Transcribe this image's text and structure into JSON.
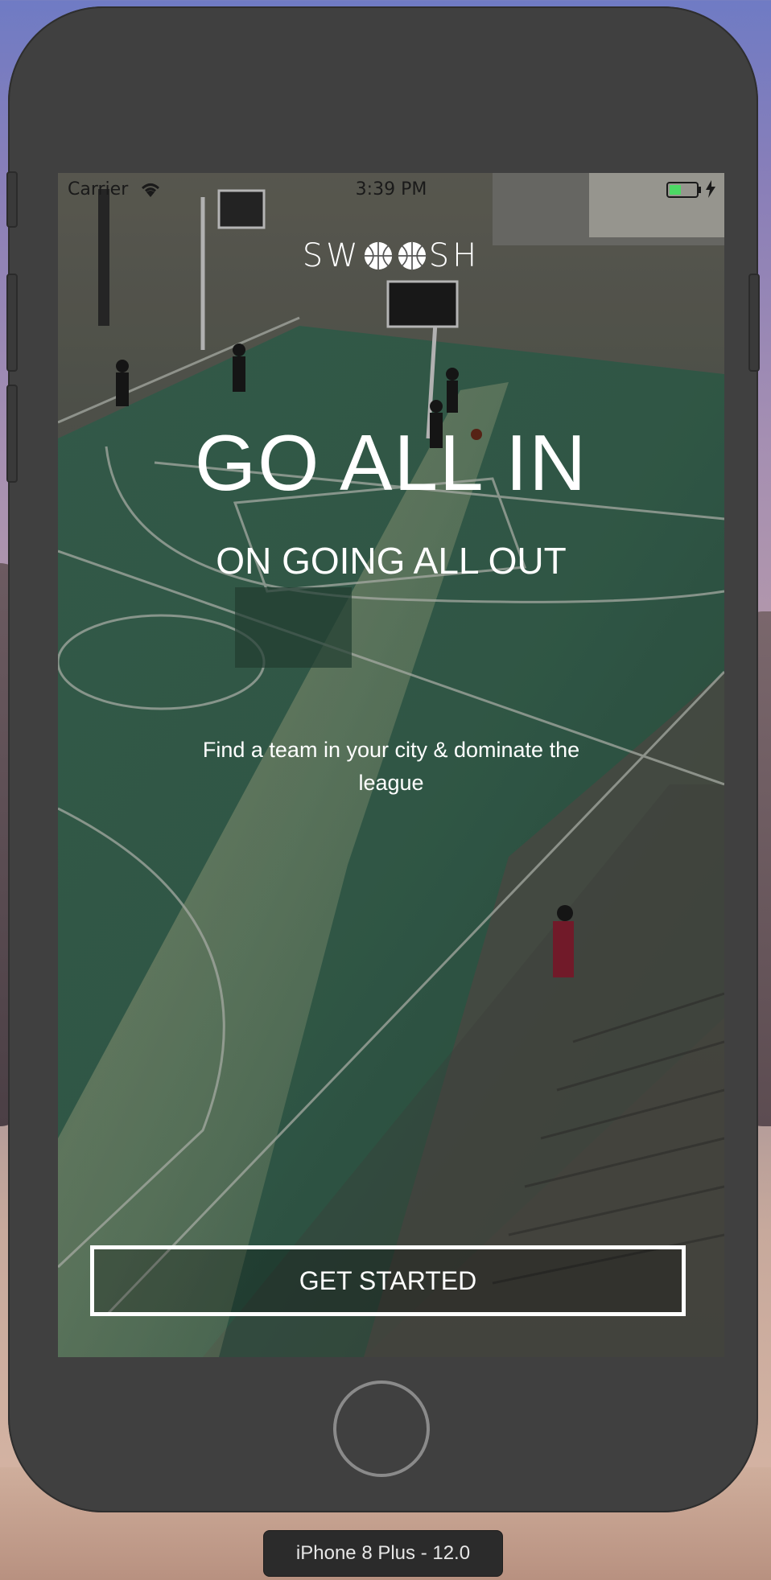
{
  "status_bar": {
    "carrier": "Carrier",
    "time": "3:39 PM",
    "battery_color": "#4cd964"
  },
  "logo": {
    "prefix": "SW",
    "suffix": "SH",
    "icon": "basketball-icon"
  },
  "hero": {
    "headline": "GO ALL IN",
    "subheadline": "ON GOING ALL OUT",
    "tagline": "Find a team in your city & dominate the league"
  },
  "cta": {
    "label": "GET STARTED"
  },
  "device": {
    "label": "iPhone 8 Plus - 12.0"
  }
}
